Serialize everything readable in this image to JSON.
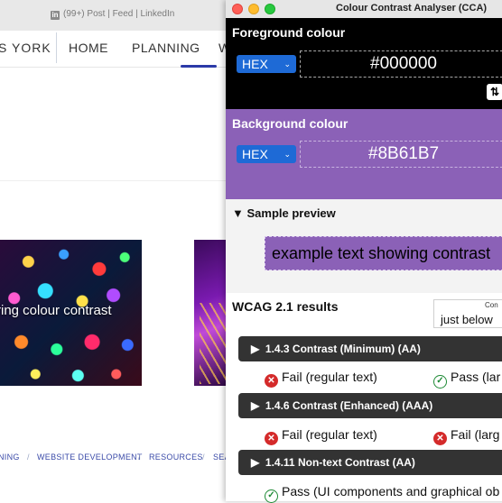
{
  "browser": {
    "tab_title": "(99+) Post | Feed | LinkedIn",
    "site_brand": "S YORK",
    "nav_items": [
      "HOME",
      "PLANNING",
      "W"
    ],
    "hero_caption": "ring colour contrast",
    "footer_links": [
      "NING",
      "/",
      "WEBSITE DEVELOPMENT",
      "/",
      "RESOURCES",
      "/",
      "SEA"
    ]
  },
  "cca": {
    "window_title": "Colour Contrast Analyser (CCA)",
    "foreground": {
      "title": "Foreground colour",
      "format": "HEX",
      "value": "#000000",
      "swap_icon": "swap-icon"
    },
    "background": {
      "title": "Background colour",
      "format": "HEX",
      "value": "#8B61B7"
    },
    "preview": {
      "title": "Sample preview",
      "sample_text": "example text showing contrast"
    },
    "results": {
      "title": "WCAG 2.1 results",
      "dropdown_label": "Con",
      "dropdown_value": "just below",
      "criteria": [
        {
          "title": "1.4.3 Contrast (Minimum) (AA)",
          "results": [
            {
              "status": "fail",
              "label": "Fail (regular text)"
            },
            {
              "status": "pass",
              "label": "Pass (lar"
            }
          ]
        },
        {
          "title": "1.4.6 Contrast (Enhanced) (AAA)",
          "results": [
            {
              "status": "fail",
              "label": "Fail (regular text)"
            },
            {
              "status": "fail",
              "label": "Fail (larg"
            }
          ]
        },
        {
          "title": "1.4.11 Non-text Contrast (AA)",
          "results": [
            {
              "status": "pass",
              "label": "Pass (UI components and graphical ob"
            }
          ]
        }
      ]
    }
  },
  "colors": {
    "foreground": "#000000",
    "background": "#8B61B7",
    "select_blue": "#1e6ad6",
    "fail_red": "#d42a2a",
    "pass_green": "#1e8a35"
  }
}
